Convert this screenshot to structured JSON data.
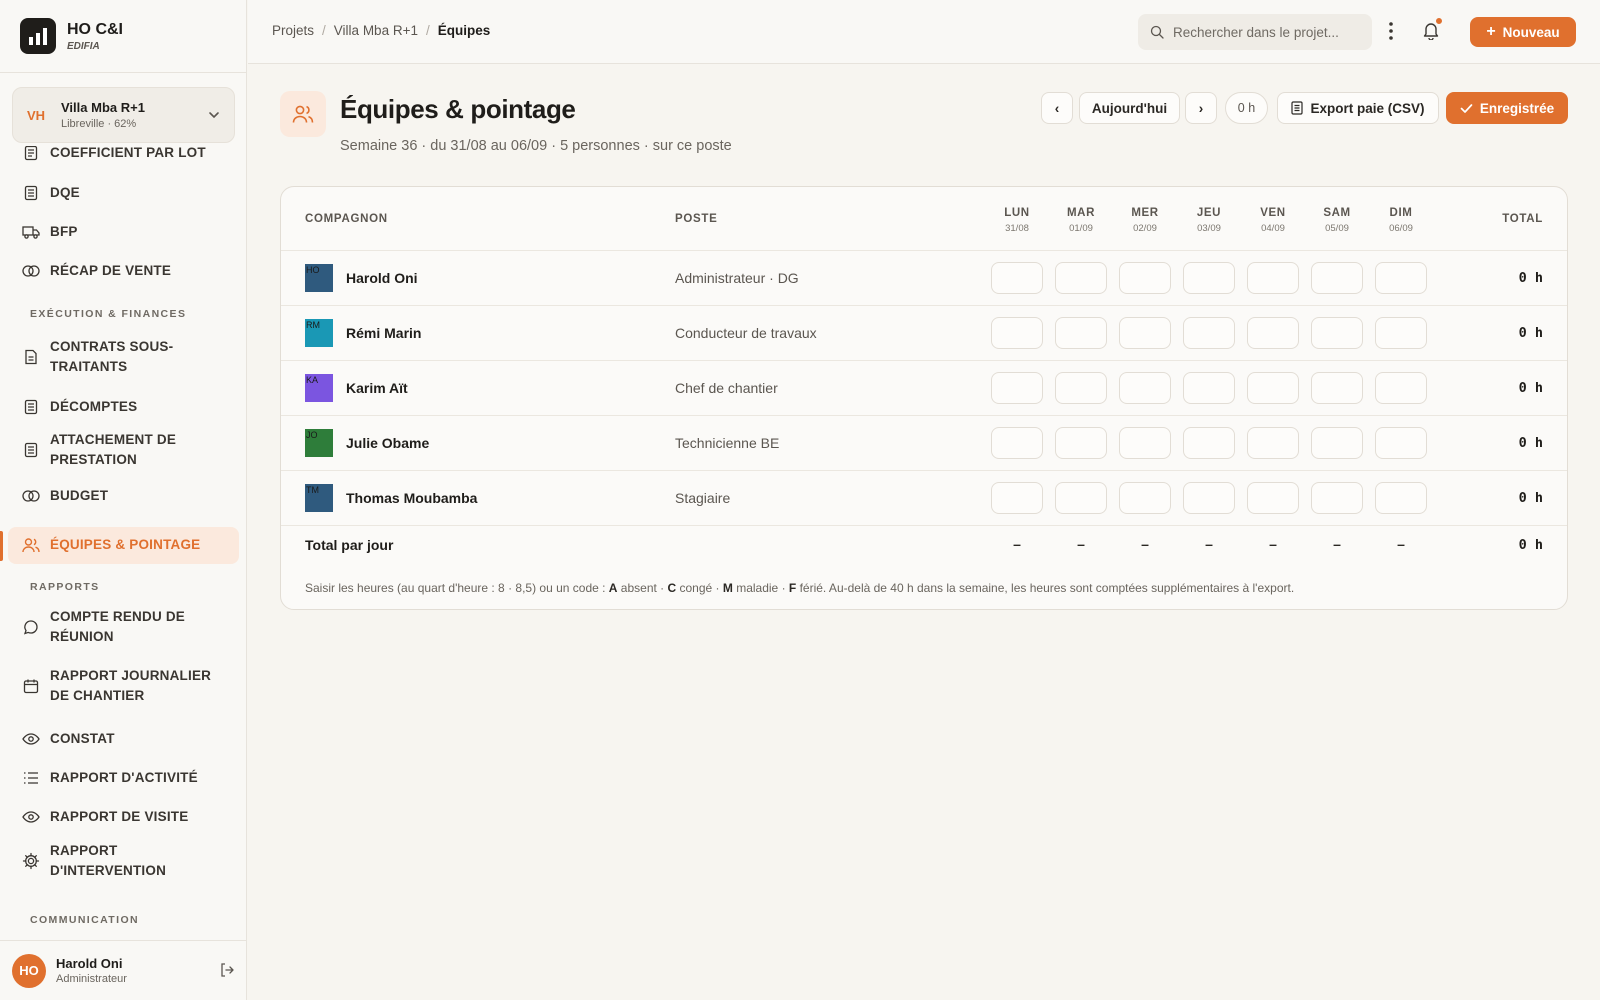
{
  "brand": {
    "name": "HO C&I",
    "sub": "EDIFIA"
  },
  "project": {
    "initials": "VH",
    "name": "Villa Mba R+1",
    "meta": "Libreville · 62%"
  },
  "nav": {
    "items": [
      {
        "label": "COEFFICIENT PAR LOT",
        "icon": "list-icon"
      },
      {
        "label": "DQE",
        "icon": "document-icon"
      },
      {
        "label": "BFP",
        "icon": "truck-icon"
      },
      {
        "label": "RÉCAP DE VENTE",
        "icon": "coins-icon"
      },
      {
        "label": "CONTRATS SOUS-TRAITANTS",
        "icon": "file-icon"
      },
      {
        "label": "DÉCOMPTES",
        "icon": "document-icon"
      },
      {
        "label": "ATTACHEMENT DE PRESTATION",
        "icon": "document-icon"
      },
      {
        "label": "BUDGET",
        "icon": "coins-icon"
      },
      {
        "label": "ÉQUIPES & POINTAGE",
        "icon": "users-icon",
        "active": true
      },
      {
        "label": "COMPTE RENDU DE RÉUNION",
        "icon": "chat-icon"
      },
      {
        "label": "RAPPORT JOURNALIER DE CHANTIER",
        "icon": "calendar-icon"
      },
      {
        "label": "CONSTAT",
        "icon": "eye-icon"
      },
      {
        "label": "RAPPORT D'ACTIVITÉ",
        "icon": "list-icon"
      },
      {
        "label": "RAPPORT DE VISITE",
        "icon": "eye-icon"
      },
      {
        "label": "RAPPORT D'INTERVENTION",
        "icon": "gear-icon"
      }
    ],
    "sections": {
      "execution": "EXÉCUTION & FINANCES",
      "rapports": "RAPPORTS",
      "communication": "COMMUNICATION"
    }
  },
  "user": {
    "initials": "HO",
    "name": "Harold Oni",
    "role": "Administrateur"
  },
  "breadcrumb": {
    "items": [
      "Projets",
      "Villa Mba R+1"
    ],
    "current": "Équipes",
    "sep": "/"
  },
  "search": {
    "placeholder": "Rechercher dans le projet..."
  },
  "top": {
    "new_label": "Nouveau",
    "new_plus": "+"
  },
  "page": {
    "title": "Équipes & pointage",
    "subtitle": "Semaine 36 · du 31/08 au 06/09 · 5 personnes · sur ce poste"
  },
  "header_actions": {
    "prev": "‹",
    "today": "Aujourd'hui",
    "next": "›",
    "hours": "0 h",
    "export": "Export paie (CSV)",
    "saved": "Enregistrée"
  },
  "table": {
    "col_name": "COMPAGNON",
    "col_role": "POSTE",
    "col_total": "TOTAL",
    "days": [
      {
        "name": "LUN",
        "date": "31/08"
      },
      {
        "name": "MAR",
        "date": "01/09"
      },
      {
        "name": "MER",
        "date": "02/09"
      },
      {
        "name": "JEU",
        "date": "03/09"
      },
      {
        "name": "VEN",
        "date": "04/09"
      },
      {
        "name": "SAM",
        "date": "05/09"
      },
      {
        "name": "DIM",
        "date": "06/09"
      }
    ],
    "rows": [
      {
        "initials": "HO",
        "name": "Harold Oni",
        "role": "Administrateur · DG",
        "color": "#2f5a7e",
        "total": "0 h"
      },
      {
        "initials": "RM",
        "name": "Rémi Marin",
        "role": "Conducteur de travaux",
        "color": "#1a98b5",
        "total": "0 h"
      },
      {
        "initials": "KA",
        "name": "Karim Aït",
        "role": "Chef de chantier",
        "color": "#7b55e0",
        "total": "0 h"
      },
      {
        "initials": "JO",
        "name": "Julie Obame",
        "role": "Technicienne BE",
        "color": "#2e7d3a",
        "total": "0 h"
      },
      {
        "initials": "TM",
        "name": "Thomas Moubamba",
        "role": "Stagiaire",
        "color": "#2f5a7e",
        "total": "0 h"
      }
    ],
    "total_label": "Total par jour",
    "day_totals": [
      "–",
      "–",
      "–",
      "–",
      "–",
      "–",
      "–"
    ],
    "grand_total": "0 h"
  },
  "help": {
    "intro": "Saisir les heures (au quart d'heure : 8 · 8,5) ou un code : ",
    "a_code": "A",
    "a_label": " absent · ",
    "c_code": "C",
    "c_label": " congé · ",
    "m_code": "M",
    "m_label": " maladie · ",
    "f_code": "F",
    "f_label": " férié. Au-delà de 40 h dans la semaine, les heures sont comptées supplémentaires à l'export."
  },
  "colors": {
    "accent": "#e0702e",
    "background": "#f7f5f0",
    "text": "#1f1d1a"
  }
}
